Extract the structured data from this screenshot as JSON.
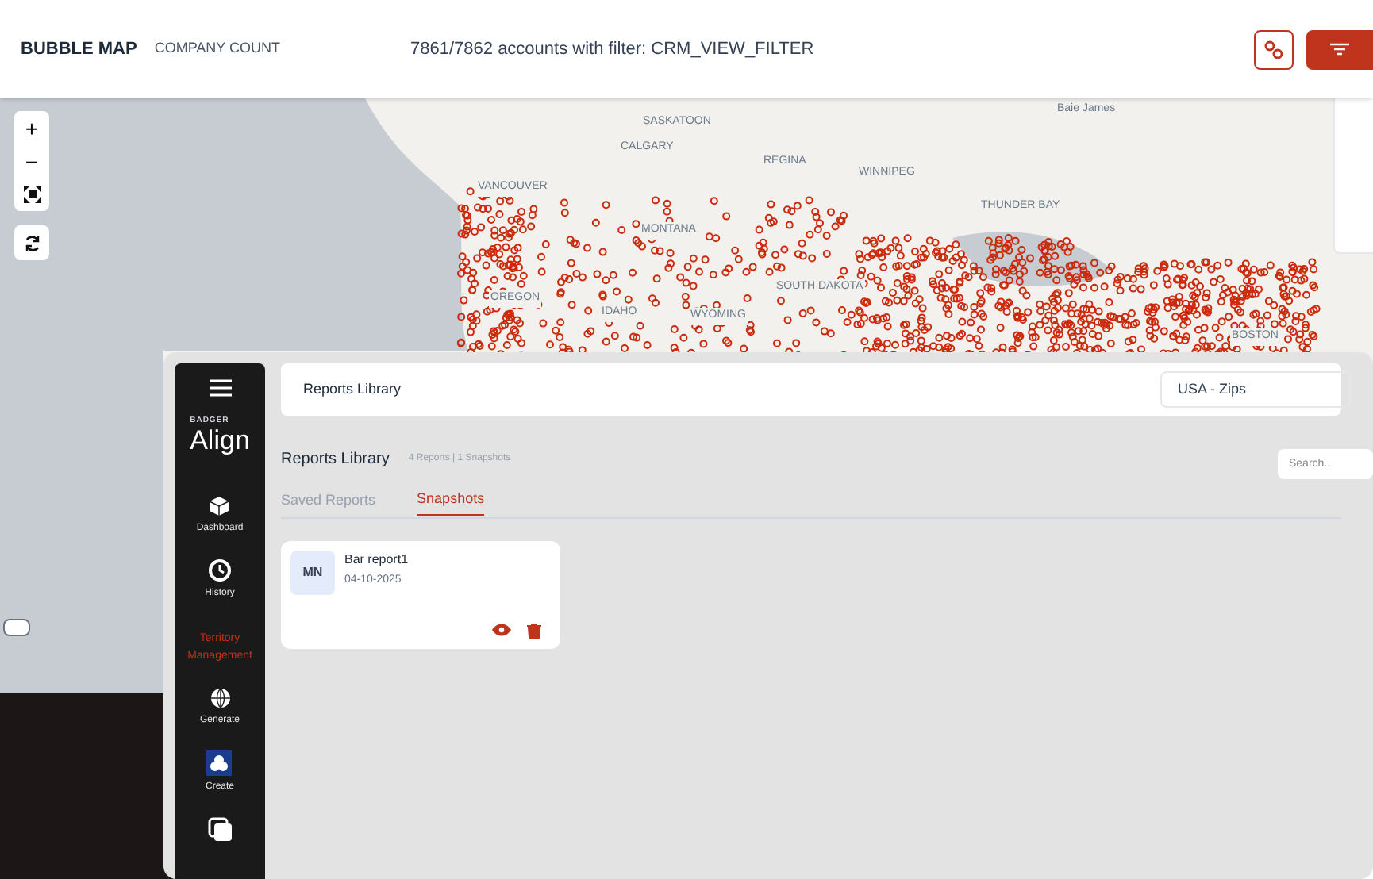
{
  "header": {
    "title": "BUBBLE MAP",
    "subtitle": "COMPANY COUNT",
    "filter_text": "7861/7862 accounts with filter: CRM_VIEW_FILTER"
  },
  "map": {
    "labels": [
      {
        "text": "SASKATOON"
      },
      {
        "text": "CALGARY"
      },
      {
        "text": "REGINA"
      },
      {
        "text": "WINNIPEG"
      },
      {
        "text": "THUNDER BAY"
      },
      {
        "text": "VANCOUVER"
      },
      {
        "text": "MONTANA"
      },
      {
        "text": "SOUTH DAKOTA"
      },
      {
        "text": "IDAHO"
      },
      {
        "text": "OREGON"
      },
      {
        "text": "WYOMING"
      },
      {
        "text": "BOSTON"
      },
      {
        "text": "Baie James"
      }
    ],
    "zoom_in": "+",
    "zoom_out": "−"
  },
  "app": {
    "brand_small": "BADGER",
    "brand": "Align",
    "nav": [
      {
        "label": "Dashboard",
        "kind": "cube",
        "selected": false
      },
      {
        "label": "History",
        "kind": "history",
        "selected": false
      },
      {
        "label": "Territory Management",
        "kind": "section",
        "selected": true
      },
      {
        "label": "Generate",
        "kind": "globe",
        "selected": false
      },
      {
        "label": "Create",
        "kind": "create",
        "selected": false
      },
      {
        "kind": "copy",
        "selected": false
      }
    ],
    "topbar_title": "Reports Library",
    "region_select": "USA - Zips",
    "page_title": "Reports Library",
    "page_meta": "4 Reports | 1 Snapshots",
    "search": {
      "placeholder": "Search.."
    },
    "tabs": [
      {
        "label": "Saved Reports",
        "selected": false
      },
      {
        "label": "Snapshots",
        "selected": true
      }
    ],
    "cards": [
      {
        "initials": "MN",
        "title": "Bar report1",
        "date": "04-10-2025"
      }
    ]
  }
}
